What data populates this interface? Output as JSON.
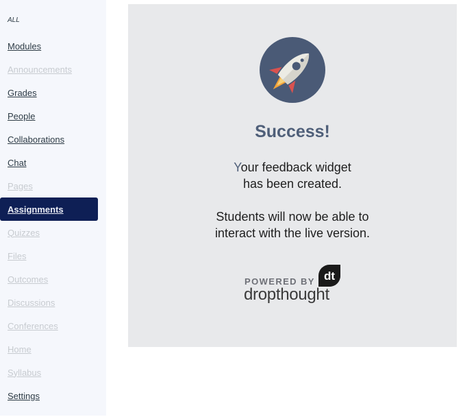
{
  "sidebar": {
    "all_label": "ALL",
    "items": [
      {
        "label": "Modules",
        "state": "enabled"
      },
      {
        "label": "Announcements",
        "state": "disabled"
      },
      {
        "label": "Grades",
        "state": "enabled"
      },
      {
        "label": "People",
        "state": "enabled"
      },
      {
        "label": "Collaborations",
        "state": "enabled"
      },
      {
        "label": "Chat",
        "state": "enabled"
      },
      {
        "label": "Pages",
        "state": "disabled"
      },
      {
        "label": "Assignments",
        "state": "active"
      },
      {
        "label": "Quizzes",
        "state": "disabled"
      },
      {
        "label": "Files",
        "state": "disabled"
      },
      {
        "label": "Outcomes",
        "state": "disabled"
      },
      {
        "label": "Discussions",
        "state": "disabled"
      },
      {
        "label": "Conferences",
        "state": "disabled"
      },
      {
        "label": "Home",
        "state": "disabled"
      },
      {
        "label": "Syllabus",
        "state": "disabled"
      },
      {
        "label": "Settings",
        "state": "enabled"
      }
    ]
  },
  "card": {
    "icon": "rocket-icon",
    "title": "Success!",
    "message_line1_first_letter": "Y",
    "message_line1_rest": "our feedback widget",
    "message_line2": "has been created.",
    "message_line3": "Students will now be able to",
    "message_line4": "interact with the live version.",
    "powered_by": "POWERED BY",
    "brand": "dropthought",
    "brand_logo_text": "dt"
  },
  "colors": {
    "active_nav_bg": "#0e1f55",
    "title": "#4f5f79",
    "rocket_circle": "#4a5a76"
  }
}
